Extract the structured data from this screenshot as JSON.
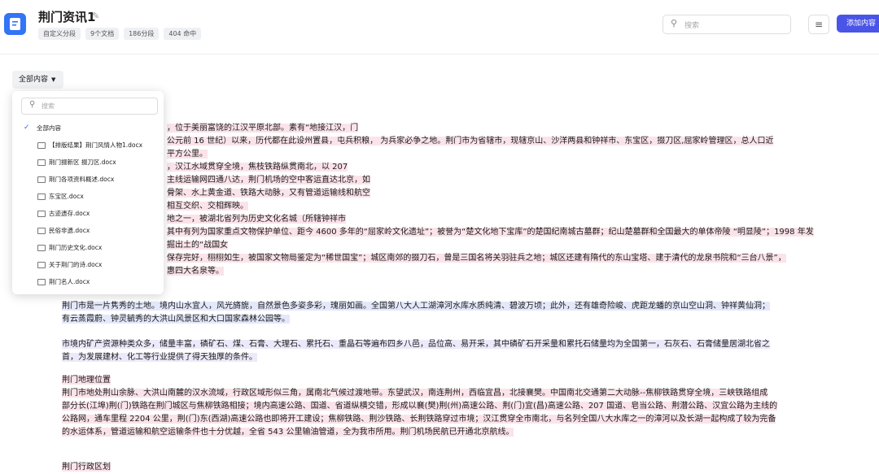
{
  "header": {
    "title": "荆门资讯1",
    "tags": [
      "自定义分段",
      "9个文档",
      "186分段",
      "404 命中"
    ],
    "search_placeholder": "搜索",
    "add_button": "添加内容"
  },
  "filter": {
    "label": "全部内容"
  },
  "dropdown": {
    "search_placeholder": "搜索",
    "all_label": "全部内容",
    "items": [
      "【排版结果】荆门风情人物1.docx",
      "荆门掇新区 掇刀区.docx",
      "荆门各项资料概述.docx",
      "东宝区.docx",
      "古迹遗存.docx",
      "民俗非遗.docx",
      "荆门历史文化.docx",
      "关于荆门的诗.docx",
      "荆门名人.docx"
    ]
  },
  "content": {
    "p1": [
      "，位于美丽富饶的江汉平原北部。素有“地接江汉，门",
      "公元前 16 世纪）以来，历代都在此设州置县，屯兵积粮， 为兵家必争之地。荆门市为省辖市，现辖京山、沙洋两县和钟祥市、东宝区，掇刀区,屈家岭管理区，总人口近",
      "平方公里。",
      "，汉江水域贯穿全境，焦枝铁路纵贯南北，以 207",
      "主线运输网四通八达，荆门机场的空中客运直达北京，如",
      "骨架、水上黄金道、铁路大动脉，又有管道运输线和航空",
      "相互交织、交相辉映。",
      "地之一，被湖北省列为历史文化名城（所辖钟祥市",
      "其中有列为国家重点文物保护单位、距今 4600 多年的“屈家岭文化遗址”；被誉为“楚文化地下宝库”的楚国纪南城古墓群；纪山楚墓群和全国最大的单体帝陵 “明显陵”；1998 年发掘出土的“战国女",
      "保存完好，栩栩如生，被国家文物局鉴定为“稀世国宝”；城区南郊的掇刀石，曾是三国名将关羽驻兵之地；城区还建有隋代的东山宝塔、建于清代的龙泉书院和“三台八景”，",
      "惠四大名泉等。"
    ],
    "p2": [
      "荆门市是一片隽秀的土地。境内山水宜人，风光旖旎，自然景色多姿多彩，瑰丽如画。全国第八大人工湖漳河水库水质纯清、碧波万顷；此外，还有雄奇险峻、虎距龙蟠的京山空山洞、钟祥黄仙洞；",
      "有云蒸霞蔚、钟灵毓秀的大洪山风景区和大口国家森林公园等。"
    ],
    "p3": [
      "市境内矿产资源种类众多，储量丰富，磷矿石、煤、石膏、大理石、累托石、重晶石等遍布四乡八邑，品位高、易开采，其中磷矿石开采量和累托石储量均为全国第一，石灰石、石膏储量居湖北省之",
      "首，为发展建材、化工等行业提供了得天独厚的条件。"
    ],
    "p4_heading": "荆门地理位置",
    "p4": [
      "荆门市地处荆山余脉、大洪山南麓的汉水流域，行政区域形似三角，属南北气候过渡地带。东望武汉，南连荆州，西临宜昌，北接襄樊。中国南北交通第二大动脉--焦柳铁路贯穿全境，三峡铁路组成",
      "部分长(江埠)荆(门)铁路在荆门城区与焦柳铁路相接；境内高速公路、国道、省道纵横交错，形成以襄(樊)荆(州)高速公路、荆(门)宜(昌)高速公路、207 国道、皂当公路、荆潜公路、汉宜公路为主线的",
      "公路网，通车里程 2204 公里，荆(门)东(西湖)高速公路也即将开工建设；焦柳铁路、荆沙铁路、长荆铁路穿过市境；汉江贯穿全市南北，与名列全国八大水库之一的漳河以及长湖一起构成了较为完备",
      "的水运体系，管道运输和航空运输条件也十分优越，全省 543 公里输油管道，全为我市所用。荆门机场民航已开通北京航线。"
    ],
    "p5_heading": "荆门行政区划"
  }
}
